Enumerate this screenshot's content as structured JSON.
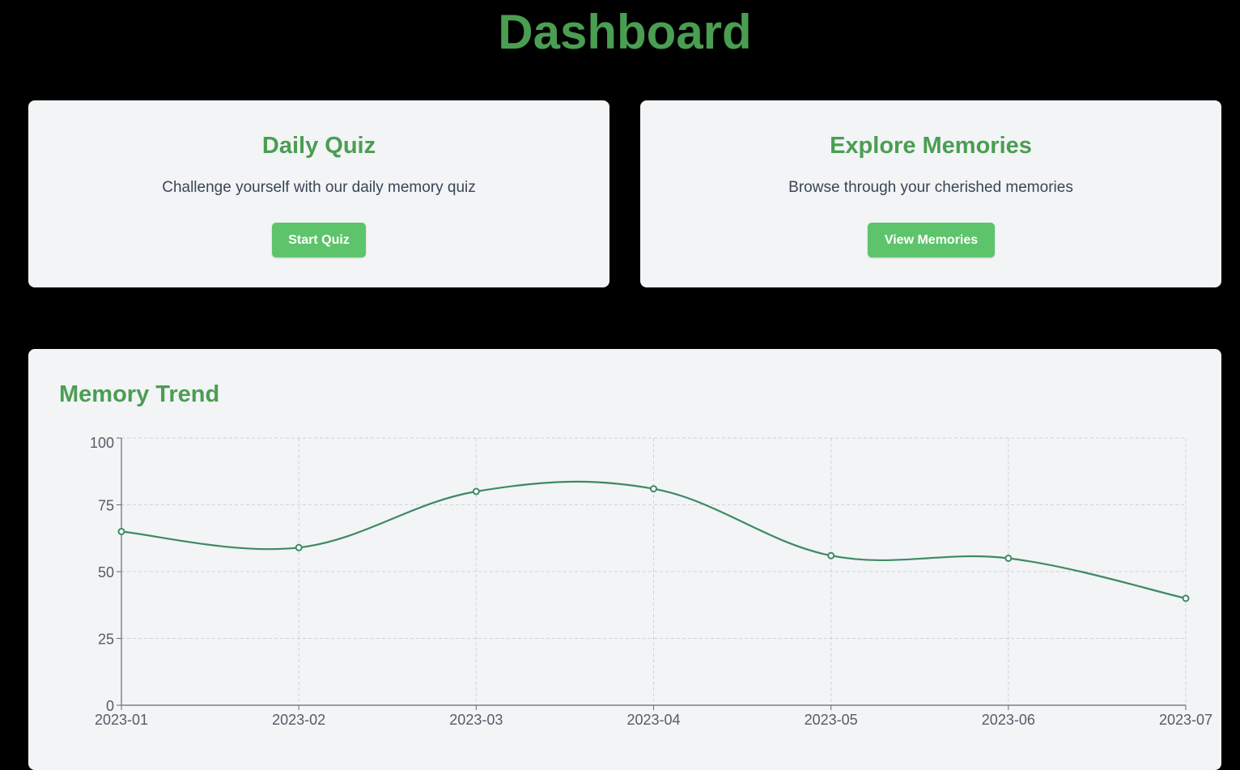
{
  "header": {
    "title": "Dashboard"
  },
  "cards": {
    "quiz": {
      "title": "Daily Quiz",
      "description": "Challenge yourself with our daily memory quiz",
      "button_label": "Start Quiz"
    },
    "memories": {
      "title": "Explore Memories",
      "description": "Browse through your cherished memories",
      "button_label": "View Memories"
    }
  },
  "trend": {
    "title": "Memory Trend"
  },
  "colors": {
    "accent": "#4a9e52",
    "button": "#5ec46b",
    "line": "#3d8a63",
    "grid": "#cfd3d8",
    "axis": "#666b72"
  },
  "chart_data": {
    "type": "line",
    "title": "Memory Trend",
    "xlabel": "",
    "ylabel": "",
    "x": [
      "2023-01",
      "2023-02",
      "2023-03",
      "2023-04",
      "2023-05",
      "2023-06",
      "2023-07"
    ],
    "series": [
      {
        "values": [
          65,
          59,
          80,
          81,
          56,
          55,
          40
        ]
      }
    ],
    "ylim": [
      0,
      100
    ],
    "yticks": [
      0,
      25,
      50,
      75,
      100
    ],
    "grid": true,
    "legend": "none"
  }
}
